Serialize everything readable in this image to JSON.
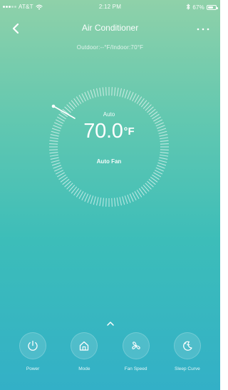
{
  "status_bar": {
    "carrier": "AT&T",
    "time": "2:12 PM",
    "battery": "67%",
    "battery_level": 0.67
  },
  "nav": {
    "title": "Air Conditioner",
    "back_icon": "chevron-left-icon",
    "more_icon": "more-dots-icon"
  },
  "conditions": {
    "text": "Outdoor:--°F/Indoor:70°F"
  },
  "thermostat": {
    "mode": "Auto",
    "temperature": "70.0",
    "unit": "°F",
    "fan": "Auto Fan"
  },
  "controls": [
    {
      "label": "Power",
      "icon": "power-icon"
    },
    {
      "label": "Mode",
      "icon": "home-icon"
    },
    {
      "label": "Fan Speed",
      "icon": "fan-icon"
    },
    {
      "label": "Sleep Curve",
      "icon": "moon-icon"
    }
  ],
  "colors": {
    "gradient_top": "#8fd1a9",
    "gradient_bottom": "#33b0c7"
  }
}
